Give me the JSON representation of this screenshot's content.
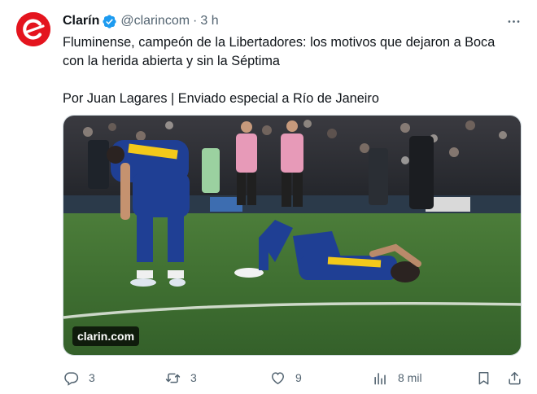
{
  "author": {
    "name": "Clarín",
    "handle": "@clarincom",
    "separator": "·",
    "time": "3 h",
    "verified": true,
    "avatar_color": "#e4141e"
  },
  "text": {
    "line1": "Fluminense, campeón de la Libertadores: los motivos que dejaron a Boca",
    "line2": "con la herida abierta y sin la Séptima",
    "byline": "Por Juan Lagares | Enviado especial a Río de Janeiro"
  },
  "media": {
    "source_label": "clarin.com",
    "kind": "photo"
  },
  "actions": {
    "replies": "3",
    "reposts": "3",
    "likes": "9",
    "views": "8 mil"
  },
  "icons": [
    "more-icon",
    "verified-badge-icon",
    "reply-icon",
    "repost-icon",
    "like-icon",
    "views-icon",
    "bookmark-icon",
    "share-icon"
  ],
  "colors": {
    "text_primary": "#0f1419",
    "text_secondary": "#536471",
    "verified_blue": "#1d9bf0",
    "border": "#cfd9de"
  }
}
